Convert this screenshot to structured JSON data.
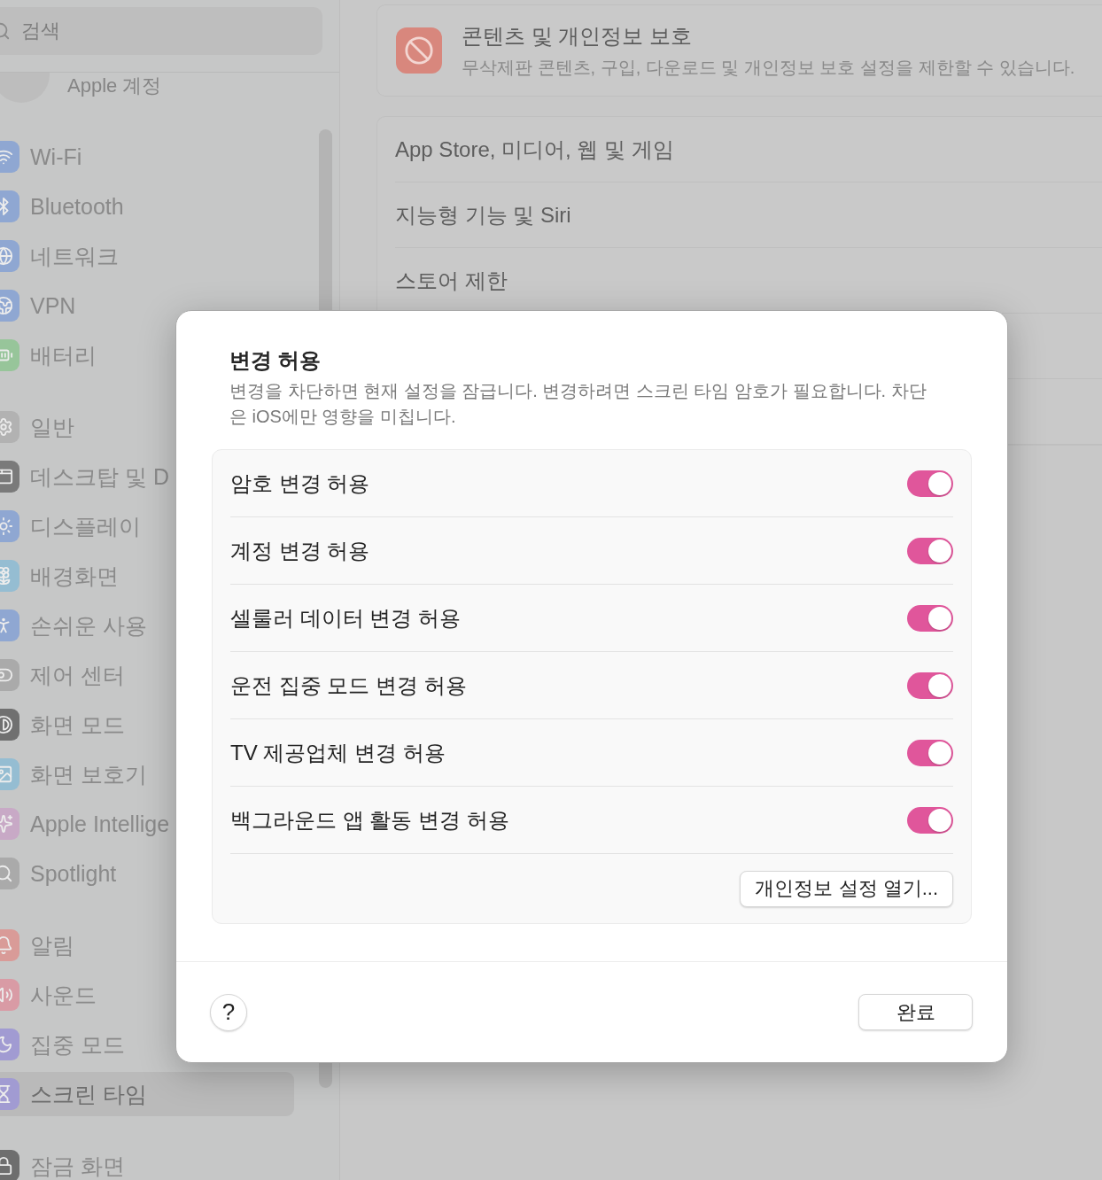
{
  "sidebar": {
    "search": {
      "placeholder": "검색"
    },
    "account": {
      "label": "Apple 계정"
    },
    "groups": [
      {
        "items": [
          {
            "label": "Wi-Fi",
            "kind": "wifi",
            "color": "#8fa7d2",
            "selected": false
          },
          {
            "label": "Bluetooth",
            "kind": "bluetooth",
            "color": "#8fa7d2",
            "selected": false
          },
          {
            "label": "네트워크",
            "kind": "globe",
            "color": "#8fa7d2",
            "selected": false
          },
          {
            "label": "VPN",
            "kind": "vpn",
            "color": "#8fa7d2",
            "selected": false
          },
          {
            "label": "배터리",
            "kind": "battery",
            "color": "#97c59a",
            "selected": false
          }
        ]
      },
      {
        "items": [
          {
            "label": "일반",
            "kind": "gear",
            "color": "#b2b2b2",
            "selected": false
          },
          {
            "label": "데스크탑 및 D",
            "kind": "desktop",
            "color": "#7a7a7a",
            "selected": false
          },
          {
            "label": "디스플레이",
            "kind": "sun",
            "color": "#8fa7d2",
            "selected": false
          },
          {
            "label": "배경화면",
            "kind": "flower",
            "color": "#95bdd2",
            "selected": false
          },
          {
            "label": "손쉬운 사용",
            "kind": "person",
            "color": "#8fa7d2",
            "selected": false
          },
          {
            "label": "제어 센터",
            "kind": "toggles",
            "color": "#aaaaaa",
            "selected": false
          },
          {
            "label": "화면 모드",
            "kind": "contrast",
            "color": "#707070",
            "selected": false
          },
          {
            "label": "화면 보호기",
            "kind": "image",
            "color": "#95bdd2",
            "selected": false
          },
          {
            "label": "Apple Intellige",
            "kind": "sparkle",
            "color": "#c8a9c6",
            "selected": false
          },
          {
            "label": "Spotlight",
            "kind": "search",
            "color": "#aaaaaa",
            "selected": false
          }
        ]
      },
      {
        "items": [
          {
            "label": "알림",
            "kind": "bell",
            "color": "#d99b98",
            "selected": false
          },
          {
            "label": "사운드",
            "kind": "speaker",
            "color": "#d99ba5",
            "selected": false
          },
          {
            "label": "집중 모드",
            "kind": "moon",
            "color": "#a19bd2",
            "selected": false
          },
          {
            "label": "스크린 타임",
            "kind": "hourglass",
            "color": "#a19bd2",
            "selected": true
          }
        ]
      },
      {
        "items": [
          {
            "label": "잠금 화면",
            "kind": "lock",
            "color": "#6e6e6e",
            "selected": false
          }
        ]
      }
    ]
  },
  "content": {
    "header": {
      "title": "콘텐츠 및 개인정보 보호",
      "subtitle": "무삭제판 콘텐츠, 구입, 다운로드 및 개인정보 보호 설정을 제한할 수 있습니다."
    },
    "rows": [
      "App Store, 미디어, 웹 및 게임",
      "지능형 기능 및 Siri",
      "스토어 제한"
    ]
  },
  "dialog": {
    "title": "변경 허용",
    "description": "변경을 차단하면 현재 설정을 잠급니다. 변경하려면 스크린 타임 암호가 필요합니다. 차단은 iOS에만 영향을 미칩니다.",
    "toggles": [
      {
        "label": "암호 변경 허용",
        "on": true
      },
      {
        "label": "계정 변경 허용",
        "on": true
      },
      {
        "label": "셀룰러 데이터 변경 허용",
        "on": true
      },
      {
        "label": "운전 집중 모드 변경 허용",
        "on": true
      },
      {
        "label": "TV 제공업체 변경 허용",
        "on": true
      },
      {
        "label": "백그라운드 앱 활동 변경 허용",
        "on": true
      }
    ],
    "privacy_button": "개인정보 설정 열기...",
    "help_button": "?",
    "done_button": "완료"
  }
}
